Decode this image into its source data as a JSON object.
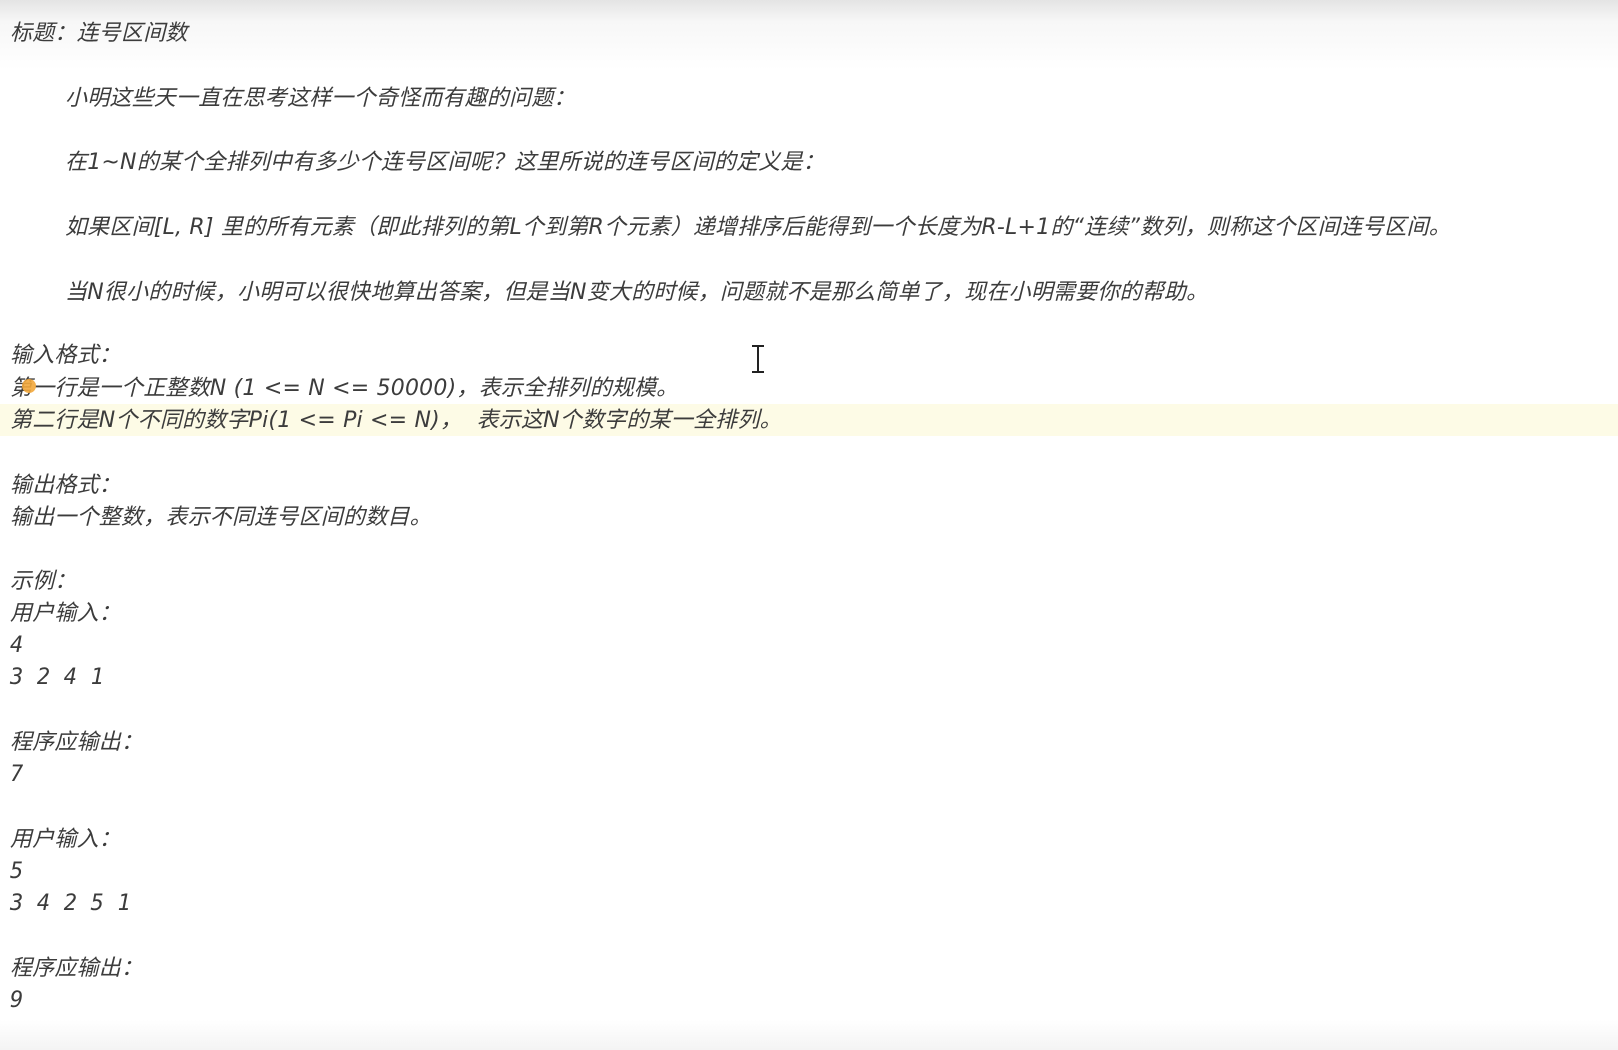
{
  "title": "标题：连号区间数",
  "description": [
    "小明这些天一直在思考这样一个奇怪而有趣的问题：",
    "在1~N的某个全排列中有多少个连号区间呢？这里所说的连号区间的定义是：",
    "如果区间[L, R] 里的所有元素（即此排列的第L个到第R个元素）递增排序后能得到一个长度为R-L+1的“连续”数列，则称这个区间连号区间。",
    "当N很小的时候，小明可以很快地算出答案，但是当N变大的时候，问题就不是那么简单了，现在小明需要你的帮助。"
  ],
  "input_format": {
    "heading": "输入格式：",
    "line1": "第一行是一个正整数N (1 <= N <= 50000)，表示全排列的规模。",
    "line2": "第二行是N个不同的数字Pi(1 <= Pi <= N)，  表示这N个数字的某一全排列。"
  },
  "output_format": {
    "heading": "输出格式：",
    "line1": "输出一个整数，表示不同连号区间的数目。"
  },
  "examples": {
    "heading": "示例：",
    "ex1": {
      "input_label": "用户输入：",
      "input_line1": "4",
      "input_line2": "3 2 4 1",
      "output_label": "程序应输出：",
      "output_value": "7"
    },
    "ex2": {
      "input_label": "用户输入：",
      "input_line1": "5",
      "input_line2": "3 4 2 5 1",
      "output_label": "程序应输出：",
      "output_value": "9"
    }
  },
  "colors": {
    "text": "#3c3c3c",
    "highlight_line": "#fdfbe6",
    "cursor_dot": "#f2a73b"
  },
  "icons": [
    "text-cursor-icon",
    "caret-marker-icon"
  ]
}
